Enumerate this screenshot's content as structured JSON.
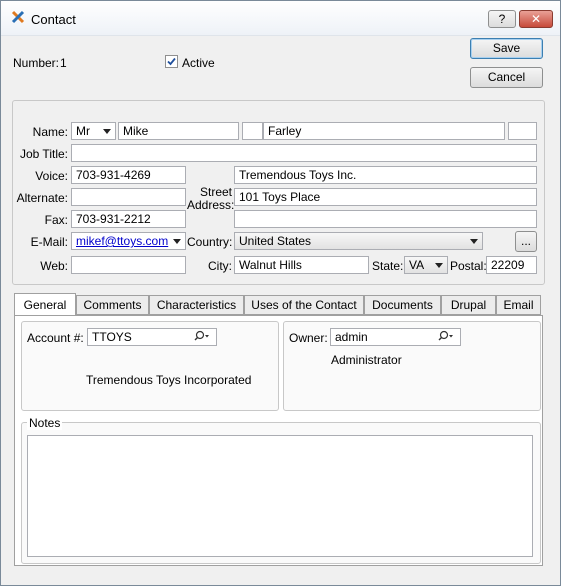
{
  "window": {
    "title": "Contact",
    "help_label": "?",
    "close_label": "✕"
  },
  "header": {
    "number_label": "Number:",
    "number_value": "1",
    "active_label": "Active",
    "active_checked": true,
    "save_label": "Save",
    "cancel_label": "Cancel"
  },
  "contact": {
    "name_label": "Name:",
    "honorific": "Mr",
    "first_name": "Mike",
    "middle_name": "",
    "last_name": "Farley",
    "suffix": "",
    "job_title_label": "Job Title:",
    "job_title": "",
    "voice_label": "Voice:",
    "voice": "703-931-4269",
    "alternate_label": "Alternate:",
    "alternate": "",
    "fax_label": "Fax:",
    "fax": "703-931-2212",
    "email_label": "E-Mail:",
    "email": "mikef@ttoys.com",
    "web_label": "Web:",
    "web": "",
    "company": "Tremendous Toys Inc.",
    "street_label_1": "Street",
    "street_label_2": "Address:",
    "street1": "101 Toys Place",
    "street2": "",
    "country_label": "Country:",
    "country": "United States",
    "more_label": "...",
    "city_label": "City:",
    "city": "Walnut Hills",
    "state_label": "State:",
    "state": "VA",
    "postal_label": "Postal:",
    "postal": "22209"
  },
  "tabs": [
    {
      "label": "General",
      "active": true
    },
    {
      "label": "Comments",
      "active": false
    },
    {
      "label": "Characteristics",
      "active": false
    },
    {
      "label": "Uses of the Contact",
      "active": false
    },
    {
      "label": "Documents",
      "active": false
    },
    {
      "label": "Drupal",
      "active": false
    },
    {
      "label": "Email",
      "active": false
    }
  ],
  "general": {
    "account_label": "Account #:",
    "account": "TTOYS",
    "account_name": "Tremendous Toys Incorporated",
    "owner_label": "Owner:",
    "owner": "admin",
    "owner_name": "Administrator",
    "notes_label": "Notes",
    "notes": ""
  },
  "icons": {
    "app": "xtuple-x-icon",
    "lookup": "magnifier-dropdown-icon"
  },
  "colors": {
    "link": "#0000cc",
    "checkbox_check": "#1f4f9c",
    "focus_border": "#3c7fb1"
  }
}
